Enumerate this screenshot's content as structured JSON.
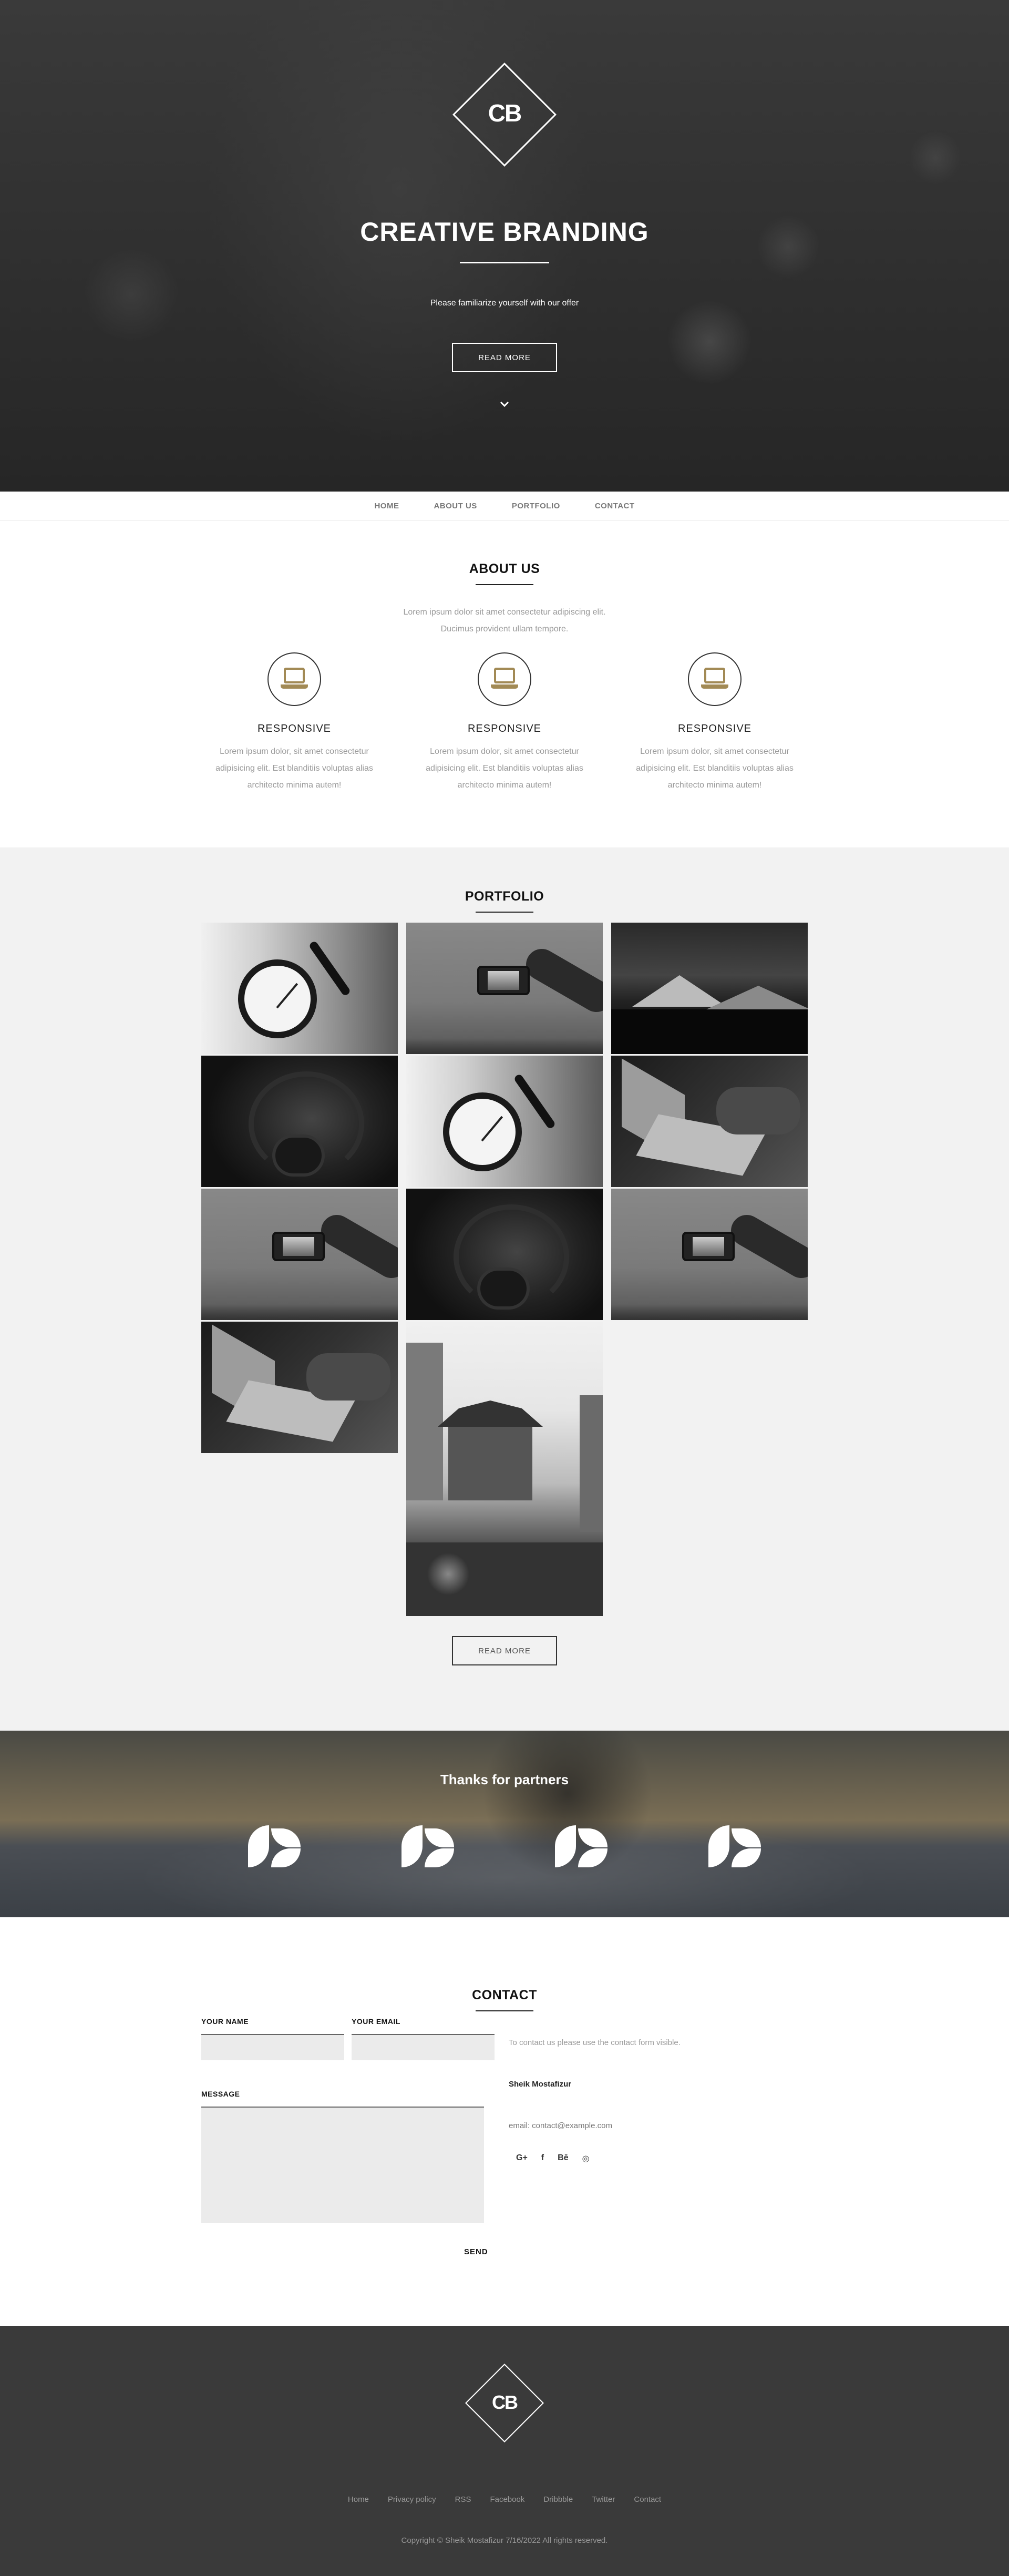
{
  "hero": {
    "logo": "CB",
    "title": "CREATIVE BRANDING",
    "subtitle": "Please familiarize yourself with our offer",
    "button": "READ MORE",
    "scroll_icon": "chevron-down-icon"
  },
  "nav": {
    "items": [
      "HOME",
      "ABOUT US",
      "PORTFOLIO",
      "CONTACT"
    ]
  },
  "about": {
    "title": "ABOUT US",
    "subtitle_line1": "Lorem ipsum dolor sit amet consectetur adipiscing elit.",
    "subtitle_line2": "Ducimus provident ullam tempore.",
    "features": [
      {
        "icon": "laptop-icon",
        "title": "RESPONSIVE",
        "text_line1": "Lorem ipsum dolor, sit amet consectetur",
        "text_line2": "adipisicing elit. Est blanditiis voluptas alias",
        "text_line3": "architecto minima autem!"
      },
      {
        "icon": "laptop-icon",
        "title": "RESPONSIVE",
        "text_line1": "Lorem ipsum dolor, sit amet consectetur",
        "text_line2": "adipisicing elit. Est blanditiis voluptas alias",
        "text_line3": "architecto minima autem!"
      },
      {
        "icon": "laptop-icon",
        "title": "RESPONSIVE",
        "text_line1": "Lorem ipsum dolor, sit amet consectetur",
        "text_line2": "adipisicing elit. Est blanditiis voluptas alias",
        "text_line3": "architecto minima autem!"
      }
    ]
  },
  "portfolio": {
    "title": "PORTFOLIO",
    "images": [
      "clock",
      "phone-photo",
      "mountains",
      "headphones",
      "clock",
      "laptop-hands",
      "phone-photo",
      "headphones",
      "phone-photo",
      "laptop-hands",
      "temple"
    ],
    "button": "READ MORE"
  },
  "partners": {
    "title": "Thanks for partners",
    "logo_count": 4
  },
  "contact": {
    "title": "CONTACT",
    "name_label": "YOUR NAME",
    "email_label": "YOUR EMAIL",
    "message_label": "MESSAGE",
    "send": "SEND",
    "info_text": "To contact us please use the contact form visible.",
    "person": "Sheik Mostafizur",
    "email_line": "email: contact@example.com",
    "socials": [
      "G+",
      "f",
      "Bē",
      "◎"
    ]
  },
  "footer": {
    "logo": "CB",
    "links": [
      "Home",
      "Privacy policy",
      "RSS",
      "Facebook",
      "Dribbble",
      "Twitter",
      "Contact"
    ],
    "copyright": "Copyright © Sheik Mostafizur 7/16/2022 All rights reserved."
  },
  "colors": {
    "accent": "#a28a55",
    "dark": "#3a3a3a",
    "light_bg": "#f2f2f2"
  }
}
